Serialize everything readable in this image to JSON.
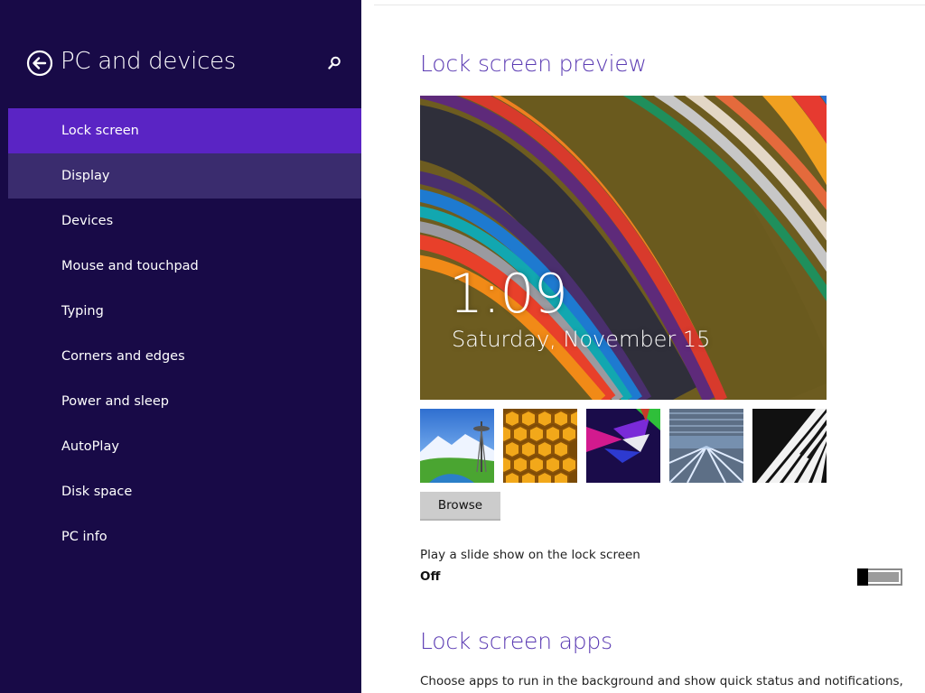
{
  "sidebar": {
    "title": "PC and devices",
    "back_icon": "back-arrow-icon",
    "search_icon": "search-icon",
    "items": [
      {
        "label": "Lock screen",
        "state": "selected"
      },
      {
        "label": "Display",
        "state": "hover"
      },
      {
        "label": "Devices",
        "state": "normal"
      },
      {
        "label": "Mouse and touchpad",
        "state": "normal"
      },
      {
        "label": "Typing",
        "state": "normal"
      },
      {
        "label": "Corners and edges",
        "state": "normal"
      },
      {
        "label": "Power and sleep",
        "state": "normal"
      },
      {
        "label": "AutoPlay",
        "state": "normal"
      },
      {
        "label": "Disk space",
        "state": "normal"
      },
      {
        "label": "PC info",
        "state": "normal"
      }
    ]
  },
  "preview": {
    "title": "Lock screen preview",
    "time": "1:09",
    "date": "Saturday, November 15"
  },
  "thumbnails": [
    {
      "name": "space-needle-thumbnail"
    },
    {
      "name": "honeycomb-thumbnail"
    },
    {
      "name": "geometric-shapes-thumbnail"
    },
    {
      "name": "escalator-thumbnail"
    },
    {
      "name": "piano-keys-thumbnail"
    }
  ],
  "browse": {
    "label": "Browse"
  },
  "slideshow": {
    "label": "Play a slide show on the lock screen",
    "state_label": "Off",
    "on": false
  },
  "apps": {
    "title": "Lock screen apps",
    "description": "Choose apps to run in the background and show quick status and notifications,"
  },
  "colors": {
    "sidebar_bg": "#180a47",
    "selected_bg": "#5a24c4",
    "hover_bg": "#3a2c6e",
    "heading": "#5b3bb3"
  }
}
